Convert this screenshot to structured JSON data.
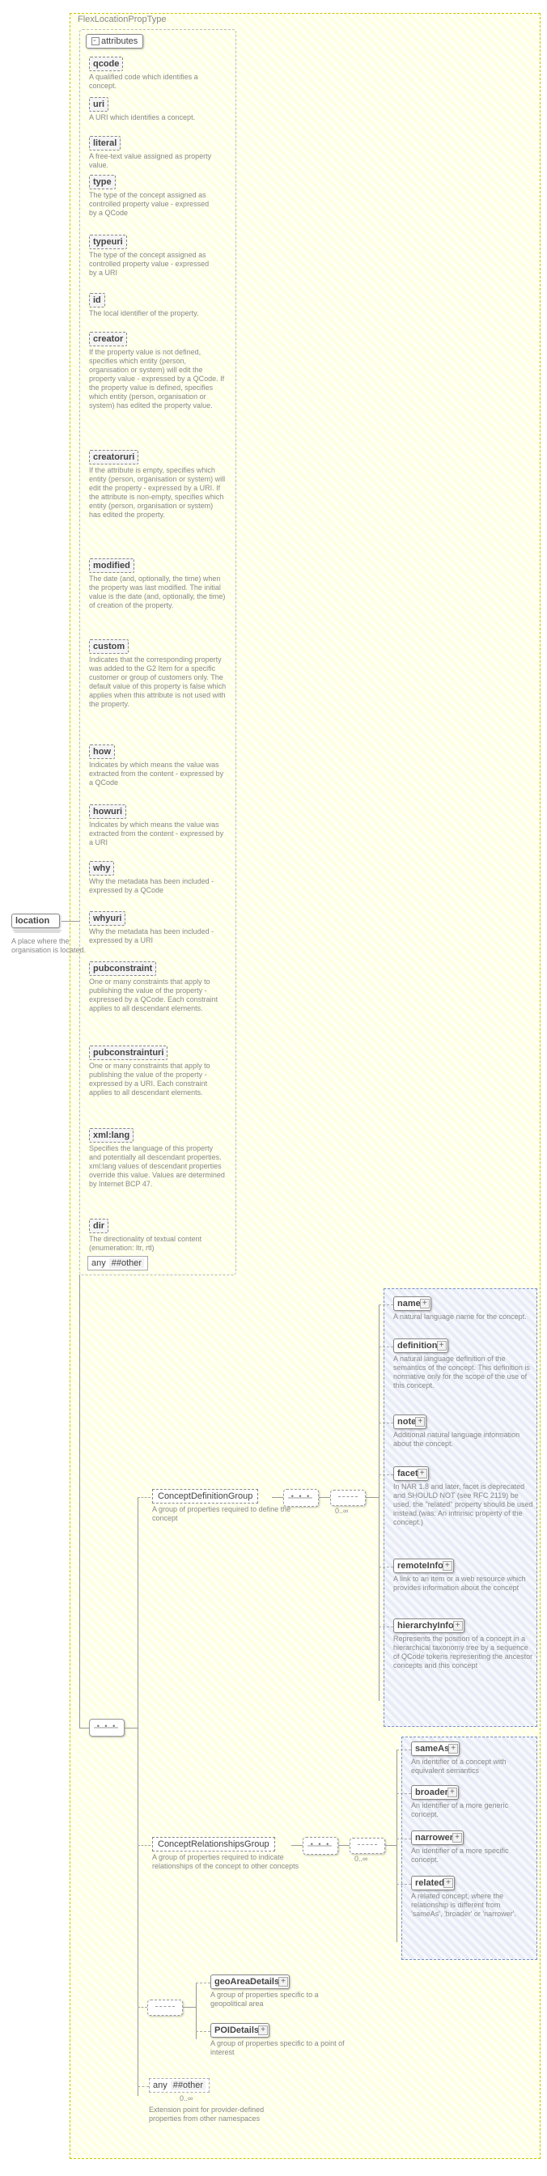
{
  "chart_data": {
    "type": "tree",
    "root": "FlexLocationPropType",
    "nodes": {
      "location": {
        "desc": "A place where the organisation is located.",
        "attributes": [
          {
            "name": "qcode",
            "desc": "A qualified code which identifies a concept."
          },
          {
            "name": "uri",
            "desc": "A URI which identifies a concept."
          },
          {
            "name": "literal",
            "desc": "A free-text value assigned as property value."
          },
          {
            "name": "type",
            "desc": "The type of the concept assigned as controlled property value - expressed by a QCode"
          },
          {
            "name": "typeuri",
            "desc": "The type of the concept assigned as controlled property value - expressed by a URI"
          },
          {
            "name": "id",
            "desc": "The local identifier of the property."
          },
          {
            "name": "creator",
            "desc": "If the property value is not defined, specifies which entity (person, organisation or system) will edit the property value - expressed by a QCode. If the property value is defined, specifies which entity (person, organisation or system) has edited the property value."
          },
          {
            "name": "creatoruri",
            "desc": "If the attribute is empty, specifies which entity (person, organisation or system) will edit the property - expressed by a URI. If the attribute is non-empty, specifies which entity (person, organisation or system) has edited the property."
          },
          {
            "name": "modified",
            "desc": "The date (and, optionally, the time) when the property was last modified. The initial value is the date (and, optionally, the time) of creation of the property."
          },
          {
            "name": "custom",
            "desc": "Indicates that the corresponding property was added to the G2 Item for a specific customer or group of customers only. The default value of this property is false which applies when this attribute is not used with the property."
          },
          {
            "name": "how",
            "desc": "Indicates by which means the value was extracted from the content - expressed by a QCode"
          },
          {
            "name": "howuri",
            "desc": "Indicates by which means the value was extracted from the content - expressed by a URI"
          },
          {
            "name": "why",
            "desc": "Why the metadata has been included - expressed by a QCode"
          },
          {
            "name": "whyuri",
            "desc": "Why the metadata has been included - expressed by a URI"
          },
          {
            "name": "pubconstraint",
            "desc": "One or many constraints that apply to publishing the value of the property - expressed by a QCode. Each constraint applies to all descendant elements."
          },
          {
            "name": "pubconstrainturi",
            "desc": "One or many constraints that apply to publishing the value of the property - expressed by a URI. Each constraint applies to all descendant elements."
          },
          {
            "name": "xml:lang",
            "desc": "Specifies the language of this property and potentially all descendant properties. xml:lang values of descendant properties override this value. Values are determined by Internet BCP 47."
          },
          {
            "name": "dir",
            "desc": "The directionality of textual content (enumeration: ltr, rtl)"
          }
        ],
        "attrWildcard": {
          "label": "any",
          "ns": "##other"
        },
        "children": [
          "sequence"
        ]
      },
      "sequence": {
        "children": [
          "ConceptDefinitionGroup",
          "ConceptRelationshipsGroup",
          "choice_geo",
          "any_other"
        ]
      },
      "ConceptDefinitionGroup": {
        "desc": "A group of properties required to define the concept",
        "occurs": "0..∞",
        "children": [
          "name",
          "definition",
          "note",
          "facet",
          "remoteInfo",
          "hierarchyInfo"
        ]
      },
      "name": {
        "desc": "A natural language name for the concept.",
        "hasExp": true
      },
      "definition": {
        "desc": "A natural language definition of the semantics of the concept. This definition is normative only for the scope of the use of this concept.",
        "hasExp": true
      },
      "note": {
        "desc": "Additional natural language information about the concept.",
        "hasExp": true
      },
      "facet": {
        "desc": "In NAR 1.8 and later, facet is deprecated and SHOULD NOT (see RFC 2119) be used, the \"related\" property should be used instead.(was: An intrinsic property of the concept.)",
        "hasExp": true
      },
      "remoteInfo": {
        "desc": "A link to an item or a web resource which provides information about the concept",
        "hasExp": true
      },
      "hierarchyInfo": {
        "desc": "Represents the position of a concept in a hierarchical taxonomy tree by a sequence of QCode tokens representing the ancestor concepts and this concept",
        "hasExp": true
      },
      "ConceptRelationshipsGroup": {
        "desc": "A group of properties required to indicate relationships of the concept to other concepts",
        "occurs": "0..∞",
        "children": [
          "sameAs",
          "broader",
          "narrower",
          "related"
        ]
      },
      "sameAs": {
        "desc": "An identifier of a concept with equivalent semantics",
        "hasExp": true
      },
      "broader": {
        "desc": "An identifier of a more generic concept.",
        "hasExp": true
      },
      "narrower": {
        "desc": "An identifier of a more specific concept.",
        "hasExp": true
      },
      "related": {
        "desc": "A related concept, where the relationship is different from 'sameAs', 'broader' or 'narrower'.",
        "hasExp": true
      },
      "choice_geo": {
        "children": [
          "geoAreaDetails",
          "POIDetails"
        ]
      },
      "geoAreaDetails": {
        "desc": "A group of properties specific to a geopolitical area",
        "hasExp": true
      },
      "POIDetails": {
        "desc": "A group of properties specific to a point of interest",
        "hasExp": true
      },
      "any_other": {
        "label": "any",
        "ns": "##other",
        "occurs": "0..∞",
        "desc": "Extension point for provider-defined properties from other namespaces"
      }
    }
  },
  "title": "FlexLocationPropType",
  "location": {
    "label": "location",
    "desc": "A place where the organisation is located."
  },
  "attrHeader": "attributes",
  "attrs": {
    "qcode": {
      "label": "qcode",
      "desc": "A qualified code which identifies a concept."
    },
    "uri": {
      "label": "uri",
      "desc": "A URI which identifies a concept."
    },
    "literal": {
      "label": "literal",
      "desc": "A free-text value assigned as property value."
    },
    "type": {
      "label": "type",
      "desc": "The type of the concept assigned as controlled property value - expressed by a QCode"
    },
    "typeuri": {
      "label": "typeuri",
      "desc": "The type of the concept assigned as controlled property value - expressed by a URI"
    },
    "id": {
      "label": "id",
      "desc": "The local identifier of the property."
    },
    "creator": {
      "label": "creator",
      "desc": "If the property value is not defined, specifies which entity (person, organisation or system) will edit the property value - expressed by a QCode. If the property value is defined, specifies which entity (person, organisation or system) has edited the property value."
    },
    "creatoruri": {
      "label": "creatoruri",
      "desc": "If the attribute is empty, specifies which entity (person, organisation or system) will edit the property - expressed by a URI. If the attribute is non-empty, specifies which entity (person, organisation or system) has edited the property."
    },
    "modified": {
      "label": "modified",
      "desc": "The date (and, optionally, the time) when the property was last modified. The initial value is the date (and, optionally, the time) of creation of the property."
    },
    "custom": {
      "label": "custom",
      "desc": "Indicates that the corresponding property was added to the G2 Item for a specific customer or group of customers only. The default value of this property is false which applies when this attribute is not used with the property."
    },
    "how": {
      "label": "how",
      "desc": "Indicates by which means the value was extracted from the content - expressed by a QCode"
    },
    "howuri": {
      "label": "howuri",
      "desc": "Indicates by which means the value was extracted from the content - expressed by a URI"
    },
    "why": {
      "label": "why",
      "desc": "Why the metadata has been included - expressed by a QCode"
    },
    "whyuri": {
      "label": "whyuri",
      "desc": "Why the metadata has been included - expressed by a URI"
    },
    "pubconstraint": {
      "label": "pubconstraint",
      "desc": "One or many constraints that apply to publishing the value of the property - expressed by a QCode. Each constraint applies to all descendant elements."
    },
    "pubconstrainturi": {
      "label": "pubconstrainturi",
      "desc": "One or many constraints that apply to publishing the value of the property - expressed by a URI. Each constraint applies to all descendant elements."
    },
    "xmllang": {
      "label": "xml:lang",
      "desc": "Specifies the language of this property and potentially all descendant properties. xml:lang values of descendant properties override this value. Values are determined by Internet BCP 47."
    },
    "dir": {
      "label": "dir",
      "desc": "The directionality of textual content (enumeration: ltr, rtl)"
    }
  },
  "attrAny": {
    "label": "any",
    "ns": "##other"
  },
  "groups": {
    "cdg": {
      "label": "ConceptDefinitionGroup",
      "desc": "A group of properties required to define the concept",
      "occ": "0..∞"
    },
    "crg": {
      "label": "ConceptRelationshipsGroup",
      "desc": "A group of properties required to indicate relationships of the concept to other concepts",
      "occ": "0..∞"
    }
  },
  "cdg": {
    "name": {
      "label": "name",
      "desc": "A natural language name for the concept."
    },
    "definition": {
      "label": "definition",
      "desc": "A natural language definition of the semantics of the concept. This definition is normative only for the scope of the use of this concept."
    },
    "note": {
      "label": "note",
      "desc": "Additional natural language information about the concept."
    },
    "facet": {
      "label": "facet",
      "desc": "In NAR 1.8 and later, facet is deprecated and SHOULD NOT (see RFC 2119) be used, the \"related\" property should be used instead.(was: An intrinsic property of the concept.)"
    },
    "remoteInfo": {
      "label": "remoteInfo",
      "desc": "A link to an item or a web resource which provides information about the concept"
    },
    "hierarchyInfo": {
      "label": "hierarchyInfo",
      "desc": "Represents the position of a concept in a hierarchical taxonomy tree by a sequence of QCode tokens representing the ancestor concepts and this concept"
    }
  },
  "crg": {
    "sameAs": {
      "label": "sameAs",
      "desc": "An identifier of a concept with equivalent semantics"
    },
    "broader": {
      "label": "broader",
      "desc": "An identifier of a more generic concept."
    },
    "narrower": {
      "label": "narrower",
      "desc": "An identifier of a more specific concept."
    },
    "related": {
      "label": "related",
      "desc": "A related concept, where the relationship is different from 'sameAs', 'broader' or 'narrower'."
    }
  },
  "geo": {
    "geoAreaDetails": {
      "label": "geoAreaDetails",
      "desc": "A group of properties specific to a geopolitical area"
    },
    "POIDetails": {
      "label": "POIDetails",
      "desc": "A group of properties specific to a point of interest"
    }
  },
  "anyOther": {
    "label": "any",
    "ns": "##other",
    "occ": "0..∞",
    "desc": "Extension point for provider-defined properties from other namespaces"
  }
}
